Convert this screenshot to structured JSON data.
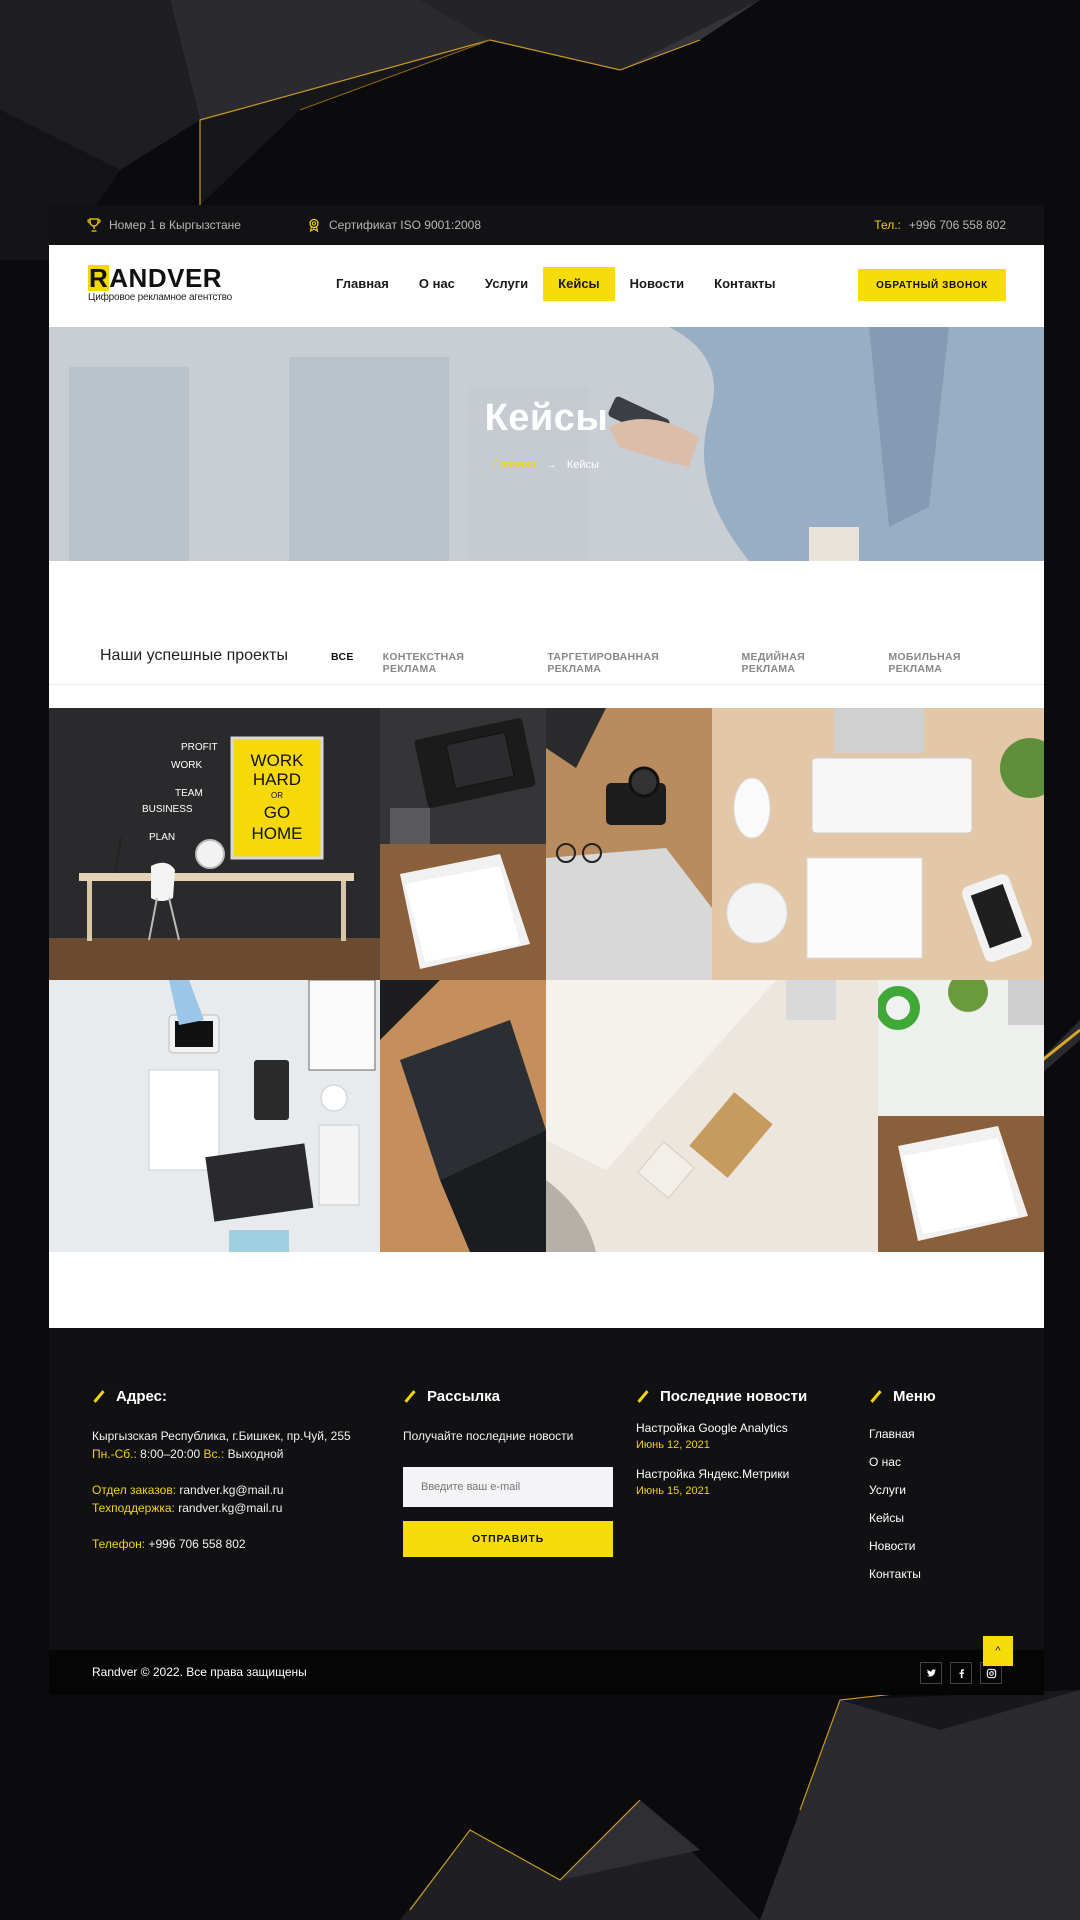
{
  "topbar": {
    "award_text": "Номер 1 в Кыргызстане",
    "cert_text": "Сертификат ISO 9001:2008",
    "phone_label": "Тел.:",
    "phone_value": "+996 706 558 802"
  },
  "header": {
    "logo_first_letter": "R",
    "logo_rest": "ANDVER",
    "logo_tagline": "Цифровое рекламное агентство",
    "nav": [
      "Главная",
      "О нас",
      "Услуги",
      "Кейсы",
      "Новости",
      "Контакты"
    ],
    "active_nav": "Кейсы",
    "callback_label": "ОБРАТНЫЙ ЗВОНОК"
  },
  "hero": {
    "title": "Кейсы",
    "breadcrumb_home": "Главная",
    "breadcrumb_arrow": "→",
    "breadcrumb_current": "Кейсы"
  },
  "projects": {
    "title": "Наши успешные проекты",
    "filters": [
      "ВСЕ",
      "КОНТЕКСТНАЯ РЕКЛАМА",
      "ТАРГЕТИРОВАННАЯ РЕКЛАМА",
      "МЕДИЙНАЯ РЕКЛАМА",
      "МОБИЛЬНАЯ РЕКЛАМА"
    ],
    "poster": {
      "line1": "WORK",
      "line2": "HARD",
      "line3": "OR",
      "line4": "GO",
      "line5": "HOME"
    },
    "wall_words": [
      "PROFIT",
      "WORK",
      "TEAM",
      "BUSINESS",
      "PLAN"
    ]
  },
  "footer": {
    "address": {
      "heading": "Адрес:",
      "line1": "Кыргызская Республика, г.Бишкек, пр.Чуй, 255",
      "hours_label": "Пн.-Сб.:",
      "hours_value": "8:00–20:00",
      "sunday_label": "Вс.:",
      "sunday_value": "Выходной",
      "orders_label": "Отдел заказов:",
      "orders_email": "randver.kg@mail.ru",
      "support_label": "Техподдержка:",
      "support_email": "randver.kg@mail.ru",
      "phone_label": "Телефон:",
      "phone_value": "+996 706 558 802"
    },
    "newsletter": {
      "heading": "Рассылка",
      "text": "Получайте последние новости",
      "placeholder": "Введите ваш e-mail",
      "button": "ОТПРАВИТЬ"
    },
    "news": {
      "heading": "Последние новости",
      "items": [
        {
          "title": "Настройка Google Analytics",
          "date": "Июнь 12, 2021"
        },
        {
          "title": "Настройка Яндекс.Метрики",
          "date": "Июнь 15, 2021"
        }
      ]
    },
    "menu": {
      "heading": "Меню",
      "items": [
        "Главная",
        "О нас",
        "Услуги",
        "Кейсы",
        "Новости",
        "Контакты"
      ]
    },
    "copyright": "Randver © 2022. Все права защищены",
    "socials": [
      "twitter-icon",
      "facebook-icon",
      "instagram-icon"
    ],
    "to_top_icon": "^"
  },
  "colors": {
    "accent": "#f7dc0c",
    "dark": "#111113"
  }
}
